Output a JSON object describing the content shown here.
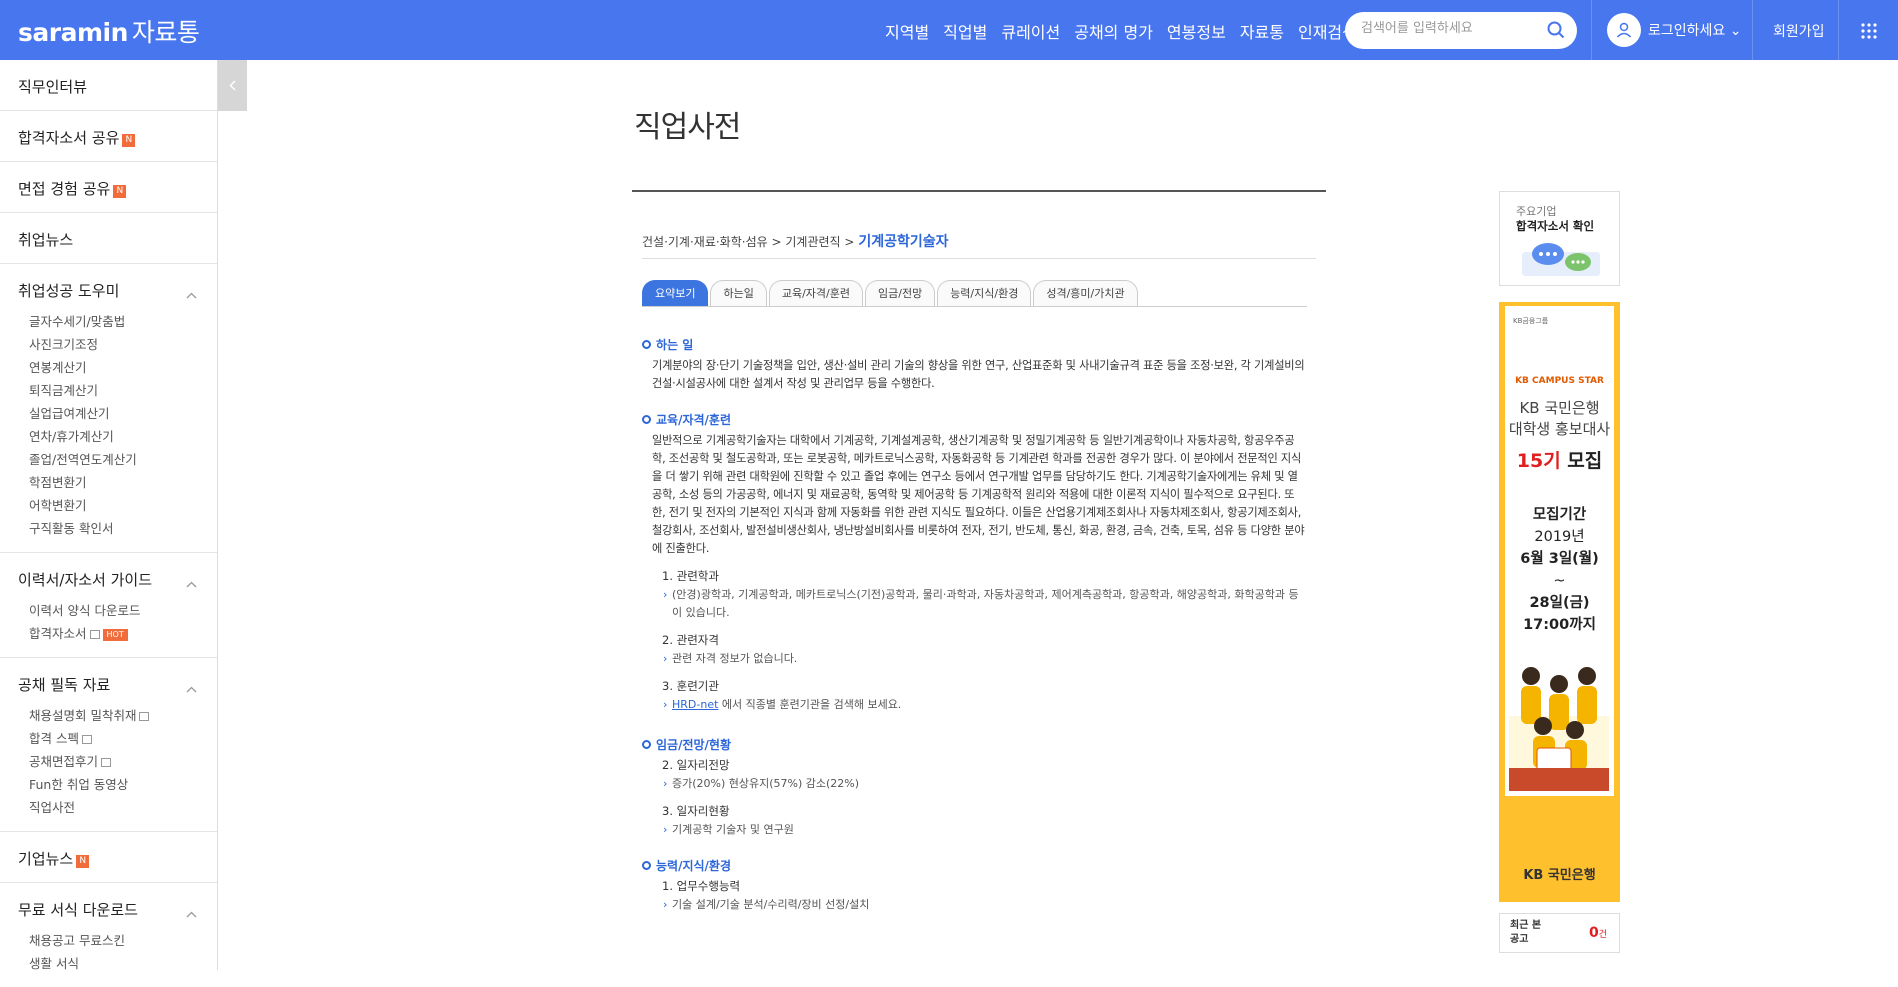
{
  "header": {
    "logo_main": "saramin",
    "logo_sub": "자료통",
    "nav": [
      "지역별",
      "직업별",
      "큐레이션",
      "공채의 명가",
      "연봉정보",
      "자료통",
      "인재검색"
    ],
    "search_placeholder": "검색어를 입력하세요",
    "login_label": "로그인하세요 ⌄",
    "join_label": "회원가입"
  },
  "sidebar": {
    "top_items": [
      {
        "label": "직무인터뷰"
      },
      {
        "label": "합격자소서 공유",
        "badge": "N"
      },
      {
        "label": "면접 경험 공유",
        "badge": "N"
      },
      {
        "label": "취업뉴스"
      }
    ],
    "group1": {
      "title": "취업성공 도우미",
      "items": [
        "글자수세기/맞춤법",
        "사진크기조정",
        "연봉계산기",
        "퇴직금계산기",
        "실업급여계산기",
        "연차/휴가계산기",
        "졸업/전역연도계산기",
        "학점변환기",
        "어학변환기",
        "구직활동 확인서"
      ]
    },
    "group2": {
      "title": "이력서/자소서 가이드",
      "items": [
        "이력서 양식 다운로드",
        "합격자소서"
      ],
      "hot": "HOT"
    },
    "group3": {
      "title": "공채 필독 자료",
      "items": [
        "채용설명회 밀착취재",
        "합격 스펙",
        "공채면접후기",
        "Fun한 취업 동영상",
        "직업사전"
      ]
    },
    "news": {
      "label": "기업뉴스",
      "badge": "N"
    },
    "group4": {
      "title": "무료 서식 다운로드",
      "items": [
        "채용공고 무료스킨",
        "생활 서식"
      ]
    }
  },
  "main": {
    "page_title": "직업사전",
    "breadcrumb": {
      "part1": "건설·기계·재료·화학·섬유",
      "sep": ">",
      "part2": "기계관련직",
      "current": "기계공학기술자"
    },
    "tabs": [
      "요약보기",
      "하는일",
      "교육/자격/훈련",
      "임금/전망",
      "능력/지식/환경",
      "성격/흥미/가치관"
    ],
    "sections": {
      "duty": {
        "title": "하는 일",
        "text": "기계분야의 장·단기 기술정책을 입안, 생산·설비 관리 기술의 향상을 위한 연구, 산업표준화 및 사내기술규격 표준 등을 조정·보완, 각 기계설비의 건설·시설공사에 대한 설계서 작성 및 관리업무 등을 수행한다."
      },
      "education": {
        "title": "교육/자격/훈련",
        "text": "일반적으로 기계공학기술자는 대학에서 기계공학, 기계설계공학, 생산기계공학 및 정밀기계공학 등 일반기계공학이나 자동차공학, 항공우주공학, 조선공학 및 철도공학과, 또는 로봇공학, 메카트로닉스공학, 자동화공학 등 기계관련 학과를 전공한 경우가 많다. 이 분야에서 전문적인 지식을 더 쌓기 위해 관련 대학원에 진학할 수 있고 졸업 후에는 연구소 등에서 연구개발 업무를 담당하기도 한다. 기계공학기술자에게는 유체 및 열공학, 소성 등의 가공공학, 에너지 및 재료공학, 동역학 및 제어공학 등 기계공학적 원리와 적용에 대한 이론적 지식이 필수적으로 요구된다. 또한, 전기 및 전자의 기본적인 지식과 함께 자동화를 위한 관련 지식도 필요하다. 이들은 산업용기계제조회사나 자동차제조회사, 항공기제조회사, 철강회사, 조선회사, 발전설비생산회사, 냉난방설비회사를 비롯하여 전자, 전기, 반도체, 통신, 화공, 환경, 금속, 건축, 토목, 섬유 등 다양한 분야에 진출한다.",
        "majors_title": "1. 관련학과",
        "majors": "(안경)광학과, 기계공학과, 메카트로닉스(기전)공학과, 물리·과학과, 자동차공학과, 제어계측공학과, 항공학과, 해양공학과, 화학공학과 등이 있습니다.",
        "cert_title": "2. 관련자격",
        "cert": "관련 자격 정보가 없습니다.",
        "train_title": "3. 훈련기관",
        "train_link": "HRD-net",
        "train_text": " 에서 직종별 훈련기관을 검색해 보세요."
      },
      "wage": {
        "title": "임금/전망/현황",
        "outlook_title": "2. 일자리전망",
        "outlook": "증가(20%) 현상유지(57%) 감소(22%)",
        "status_title": "3. 일자리현황",
        "status": "기계공학 기술자 및 연구원"
      },
      "ability": {
        "title": "능력/지식/환경",
        "skill_title": "1. 업무수행능력",
        "skill": "기술 설계/기술 분석/수리력/장비 선정/설치"
      }
    }
  },
  "right": {
    "box1_line1": "주요기업",
    "box1_line2": "합격자소서 확인",
    "kb": {
      "small": "KB금융그룹",
      "campus": "KB CAMPUS STAR",
      "title1": "KB 국민은행",
      "title2": "대학생 홍보대사",
      "big_red": "15기",
      "big_black": " 모집",
      "period_label": "모집기간",
      "year": "2019년",
      "start": "6월 3일(월)",
      "tilde": "~",
      "end": "28일(금)",
      "time": "17:00까지",
      "footer": "KB 국민은행"
    },
    "recent_label": "최근 본 공고",
    "recent_count": "0",
    "recent_unit": "건"
  },
  "colors": {
    "brand_blue": "#4876ef",
    "link_blue": "#2c66d8",
    "kb_yellow": "#ffc02d",
    "badge_orange": "#f26b3a"
  }
}
